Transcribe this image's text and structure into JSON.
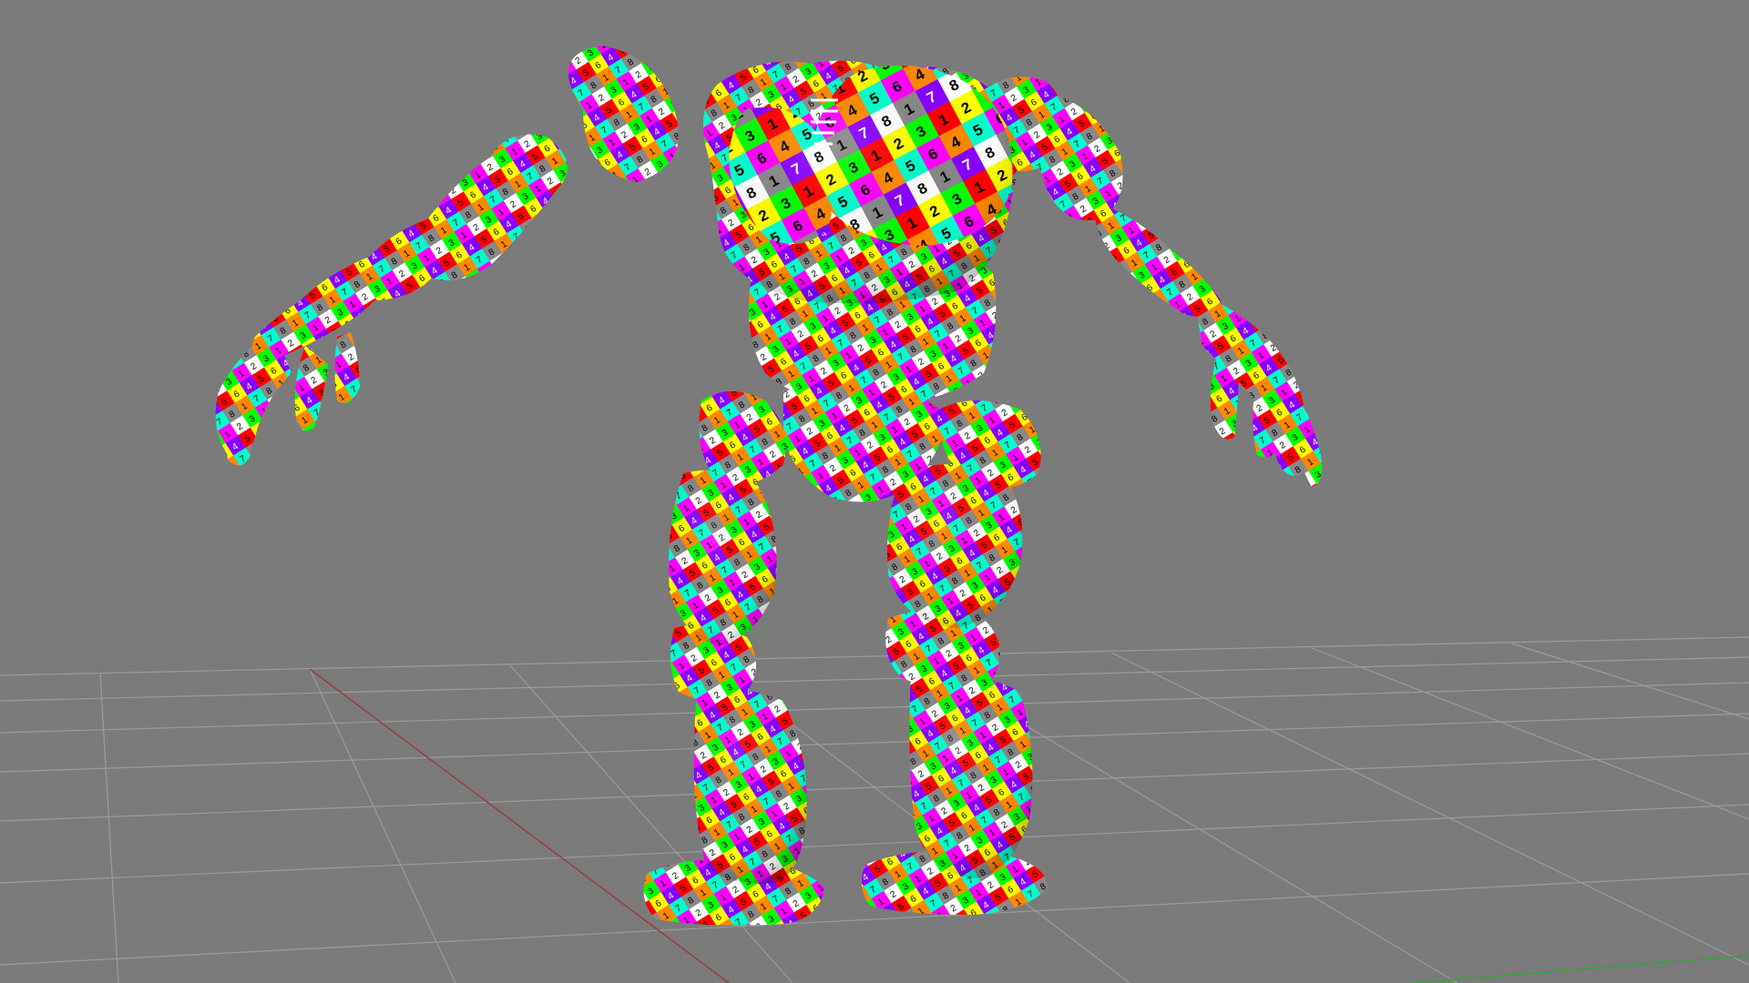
{
  "viewport": {
    "background_color": "#7b7b7b",
    "grid_color": "#9a9a9a",
    "axis_x_color": "#a23a3a",
    "axis_z_color": "#3aa23a",
    "model_name": "uv-checker-mech-robot"
  },
  "model": {
    "texture": "uv-checker",
    "checker_colors": [
      "#ff00ff",
      "#8800ff",
      "#ff0000",
      "#ff8800",
      "#ffff00",
      "#00ff00",
      "#00ffcc",
      "#00aaff",
      "#ffffff",
      "#888888"
    ],
    "checker_labels": [
      "1",
      "2",
      "3",
      "4",
      "5",
      "6",
      "7",
      "8"
    ]
  }
}
